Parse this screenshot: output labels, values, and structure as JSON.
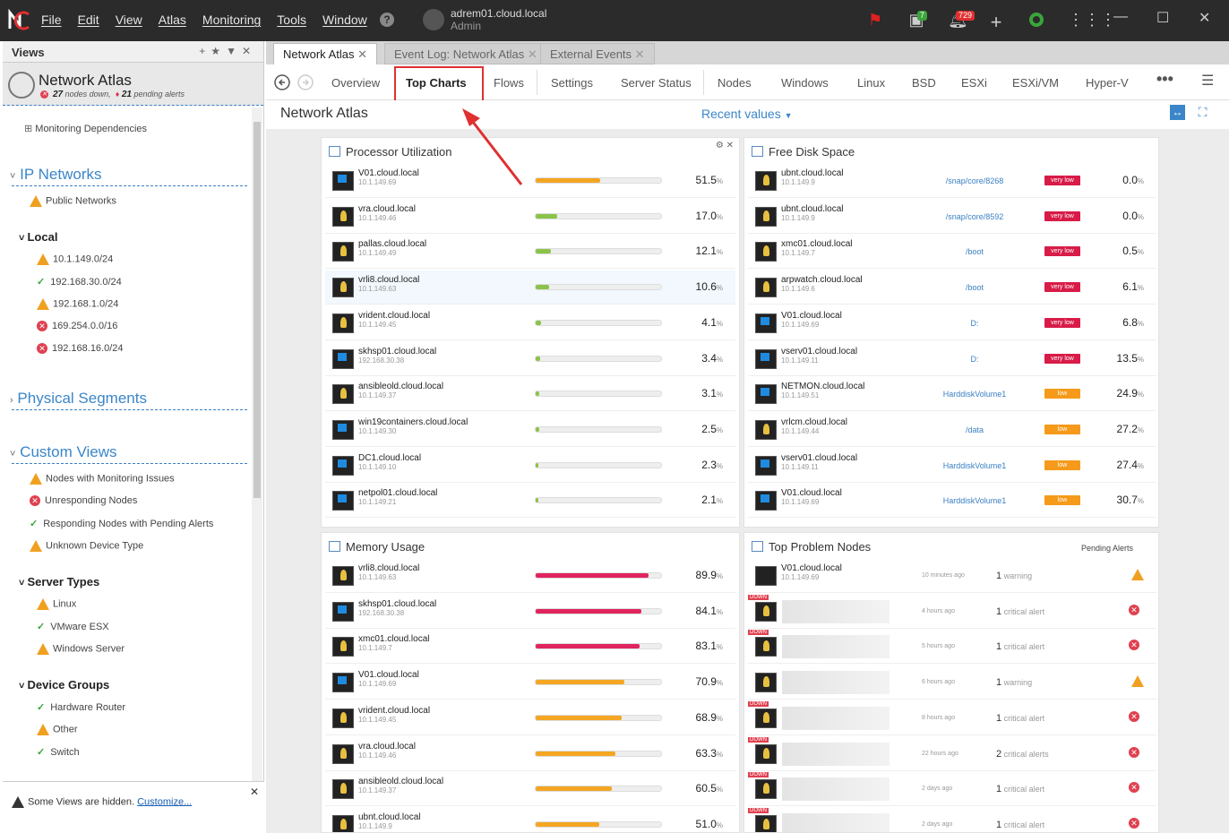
{
  "menu": [
    "File",
    "Edit",
    "View",
    "Atlas",
    "Monitoring",
    "Tools",
    "Window"
  ],
  "user": {
    "name": "adrem01.cloud.local",
    "role": "Admin"
  },
  "badges": {
    "updates": "7",
    "alerts": "729"
  },
  "views": {
    "header": "Views",
    "atlas_title": "Network Atlas",
    "nodes_down": "27",
    "nodes_down_label": "nodes down,",
    "pending_alerts": "21",
    "pending_alerts_label": "pending alerts",
    "dependencies": "Monitoring Dependencies",
    "ip_networks": "IP Networks",
    "public": "Public Networks",
    "local": "Local",
    "subnets": [
      {
        "label": "10.1.149.0/24",
        "status": "warn"
      },
      {
        "label": "192.168.30.0/24",
        "status": "ok"
      },
      {
        "label": "192.168.1.0/24",
        "status": "warn"
      },
      {
        "label": "169.254.0.0/16",
        "status": "err"
      },
      {
        "label": "192.168.16.0/24",
        "status": "err"
      }
    ],
    "physical": "Physical Segments",
    "custom": "Custom Views",
    "custom_items": [
      {
        "label": "Nodes with Monitoring Issues",
        "status": "warn"
      },
      {
        "label": "Unresponding Nodes",
        "status": "err"
      },
      {
        "label": "Responding Nodes with Pending Alerts",
        "status": "ok"
      },
      {
        "label": "Unknown Device Type",
        "status": "warn"
      }
    ],
    "server_types": "Server Types",
    "server_items": [
      {
        "label": "Linux",
        "status": "warn"
      },
      {
        "label": "VMware ESX",
        "status": "ok"
      },
      {
        "label": "Windows Server",
        "status": "warn"
      }
    ],
    "device_groups": "Device Groups",
    "device_items": [
      {
        "label": "Hardware Router",
        "status": "ok"
      },
      {
        "label": "Other",
        "status": "warn"
      },
      {
        "label": "Switch",
        "status": "ok"
      }
    ],
    "footer_text": "Some Views are hidden.",
    "footer_link": "Customize..."
  },
  "doc_tabs": [
    "Network Atlas",
    "Event Log: Network Atlas",
    "External Events"
  ],
  "nav": [
    "Overview",
    "Top Charts",
    "Flows",
    "Settings",
    "Server Status",
    "Nodes",
    "Windows",
    "Linux",
    "BSD",
    "ESXi",
    "ESXi/VM",
    "Hyper-V"
  ],
  "page_title": "Network Atlas",
  "recent": "Recent values",
  "proc": {
    "title": "Processor Utilization",
    "rows": [
      {
        "name": "V01.cloud.local",
        "ip": "10.1.149.69",
        "os": "win",
        "pct": 51.5,
        "val": "51.5"
      },
      {
        "name": "vra.cloud.local",
        "ip": "10.1.149.46",
        "os": "lin",
        "pct": 17.0,
        "val": "17.0"
      },
      {
        "name": "pallas.cloud.local",
        "ip": "10.1.149.49",
        "os": "lin",
        "pct": 12.1,
        "val": "12.1"
      },
      {
        "name": "vrli8.cloud.local",
        "ip": "10.1.149.63",
        "os": "lin",
        "pct": 10.6,
        "val": "10.6"
      },
      {
        "name": "vrident.cloud.local",
        "ip": "10.1.149.45",
        "os": "lin",
        "pct": 4.1,
        "val": "4.1"
      },
      {
        "name": "skhsp01.cloud.local",
        "ip": "192.168.30.38",
        "os": "win",
        "pct": 3.4,
        "val": "3.4"
      },
      {
        "name": "ansibleold.cloud.local",
        "ip": "10.1.149.37",
        "os": "lin",
        "pct": 3.1,
        "val": "3.1"
      },
      {
        "name": "win19containers.cloud.local",
        "ip": "10.1.149.30",
        "os": "win",
        "pct": 2.5,
        "val": "2.5"
      },
      {
        "name": "DC1.cloud.local",
        "ip": "10.1.149.10",
        "os": "win",
        "pct": 2.3,
        "val": "2.3"
      },
      {
        "name": "netpol01.cloud.local",
        "ip": "10.1.149.21",
        "os": "win",
        "pct": 2.1,
        "val": "2.1"
      }
    ]
  },
  "disk": {
    "title": "Free Disk Space",
    "rows": [
      {
        "name": "ubnt.cloud.local",
        "ip": "10.1.149.9",
        "os": "lin",
        "vol": "/snap/core/8268",
        "tag": "very low",
        "val": "0.0"
      },
      {
        "name": "ubnt.cloud.local",
        "ip": "10.1.149.9",
        "os": "lin",
        "vol": "/snap/core/8592",
        "tag": "very low",
        "val": "0.0"
      },
      {
        "name": "xmc01.cloud.local",
        "ip": "10.1.149.7",
        "os": "lin",
        "vol": "/boot",
        "tag": "very low",
        "val": "0.5"
      },
      {
        "name": "arpwatch.cloud.local",
        "ip": "10.1.149.6",
        "os": "lin",
        "vol": "/boot",
        "tag": "very low",
        "val": "6.1"
      },
      {
        "name": "V01.cloud.local",
        "ip": "10.1.149.69",
        "os": "win",
        "vol": "D:",
        "tag": "very low",
        "val": "6.8"
      },
      {
        "name": "vserv01.cloud.local",
        "ip": "10.1.149.11",
        "os": "win",
        "vol": "D:",
        "tag": "very low",
        "val": "13.5"
      },
      {
        "name": "NETMON.cloud.local",
        "ip": "10.1.149.51",
        "os": "win",
        "vol": "HarddiskVolume1",
        "tag": "low",
        "val": "24.9"
      },
      {
        "name": "vrlcm.cloud.local",
        "ip": "10.1.149.44",
        "os": "lin",
        "vol": "/data",
        "tag": "low",
        "val": "27.2"
      },
      {
        "name": "vserv01.cloud.local",
        "ip": "10.1.149.11",
        "os": "win",
        "vol": "HarddiskVolume1",
        "tag": "low",
        "val": "27.4"
      },
      {
        "name": "V01.cloud.local",
        "ip": "10.1.149.69",
        "os": "win",
        "vol": "HarddiskVolume1",
        "tag": "low",
        "val": "30.7"
      }
    ]
  },
  "mem": {
    "title": "Memory Usage",
    "rows": [
      {
        "name": "vrli8.cloud.local",
        "ip": "10.1.149.63",
        "os": "lin",
        "pct": 89.9,
        "val": "89.9"
      },
      {
        "name": "skhsp01.cloud.local",
        "ip": "192.168.30.38",
        "os": "win",
        "pct": 84.1,
        "val": "84.1"
      },
      {
        "name": "xmc01.cloud.local",
        "ip": "10.1.149.7",
        "os": "lin",
        "pct": 83.1,
        "val": "83.1"
      },
      {
        "name": "V01.cloud.local",
        "ip": "10.1.149.69",
        "os": "win",
        "pct": 70.9,
        "val": "70.9"
      },
      {
        "name": "vrident.cloud.local",
        "ip": "10.1.149.45",
        "os": "lin",
        "pct": 68.9,
        "val": "68.9"
      },
      {
        "name": "vra.cloud.local",
        "ip": "10.1.149.46",
        "os": "lin",
        "pct": 63.3,
        "val": "63.3"
      },
      {
        "name": "ansibleold.cloud.local",
        "ip": "10.1.149.37",
        "os": "lin",
        "pct": 60.5,
        "val": "60.5"
      },
      {
        "name": "ubnt.cloud.local",
        "ip": "10.1.149.9",
        "os": "lin",
        "pct": 51.0,
        "val": "51.0"
      }
    ]
  },
  "problems": {
    "title": "Top Problem Nodes",
    "col": "Pending Alerts",
    "rows": [
      {
        "name": "V01.cloud.local",
        "ip": "10.1.149.69",
        "down": false,
        "time": "10 minutes ago",
        "count": "1",
        "label": "warning",
        "sev": "warn"
      },
      {
        "name": "",
        "ip": "",
        "down": true,
        "time": "4 hours ago",
        "count": "1",
        "label": "critical alert",
        "sev": "err"
      },
      {
        "name": "",
        "ip": "",
        "down": true,
        "time": "5 hours ago",
        "count": "1",
        "label": "critical alert",
        "sev": "err"
      },
      {
        "name": "",
        "ip": "",
        "down": false,
        "time": "6 hours ago",
        "count": "1",
        "label": "warning",
        "sev": "warn"
      },
      {
        "name": "",
        "ip": "",
        "down": true,
        "time": "8 hours ago",
        "count": "1",
        "label": "critical alert",
        "sev": "err"
      },
      {
        "name": "",
        "ip": "",
        "down": true,
        "time": "22 hours ago",
        "count": "2",
        "label": "critical alerts",
        "sev": "err"
      },
      {
        "name": "",
        "ip": "",
        "down": true,
        "time": "2 days ago",
        "count": "1",
        "label": "critical alert",
        "sev": "err"
      },
      {
        "name": "",
        "ip": "",
        "down": true,
        "time": "2 days ago",
        "count": "1",
        "label": "critical alert",
        "sev": "err"
      }
    ]
  },
  "down_label": "DOWN",
  "pct_unit": "%",
  "colors": {
    "accent": "#3a86c8",
    "orange": "#f5a623",
    "green": "#8bc34a",
    "red": "#e0245e",
    "verylow": "#d81b47",
    "low": "#f59a1a"
  }
}
